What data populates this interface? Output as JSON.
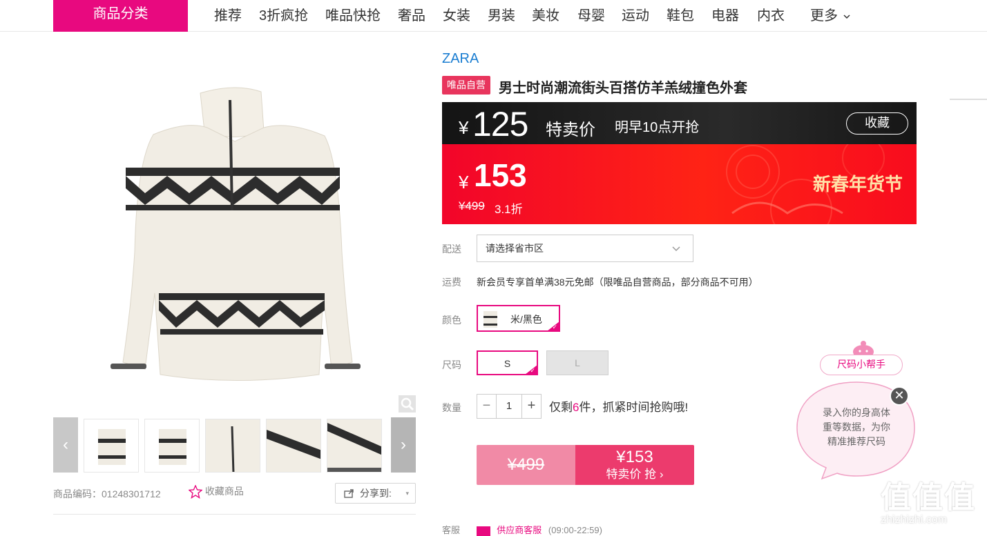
{
  "nav": {
    "category_button": "商品分类",
    "items": [
      "推荐",
      "3折疯抢",
      "唯品快抢",
      "奢品",
      "女装",
      "男装",
      "美妆",
      "母婴",
      "运动",
      "鞋包",
      "电器",
      "内衣"
    ],
    "more": "更多"
  },
  "product": {
    "brand": "ZARA",
    "badge": "唯品自营",
    "title": "男士时尚潮流街头百搭仿羊羔绒撞色外套",
    "code_label": "商品编码：01248301712",
    "favorite_label": "收藏商品",
    "share_label": "分享到:"
  },
  "promo": {
    "currency": "¥",
    "special_price": "125",
    "special_label": "特卖价",
    "start_time": "明早10点开抢",
    "collect_label": "收藏",
    "current_price": "153",
    "original_price": "¥499",
    "discount": "3.1折",
    "festival": "新春年货节"
  },
  "options": {
    "delivery_label": "配送",
    "delivery_placeholder": "请选择省市区",
    "shipping_label": "运费",
    "shipping_text": "新会员专享首单满38元免邮（限唯品自营商品，部分商品不可用）",
    "color_label": "颜色",
    "color_value": "米/黑色",
    "size_label": "尺码",
    "sizes": [
      "S",
      "L"
    ],
    "qty_label": "数量",
    "qty_value": "1",
    "stock_prefix": "仅剩",
    "stock_count": "6",
    "stock_suffix": "件，抓紧时间抢购哦!"
  },
  "buy": {
    "original_price": "¥499",
    "price": "¥153",
    "action": "特卖价 抢"
  },
  "helper": {
    "title": "尺码小帮手",
    "text_line1": "录入你的身高体",
    "text_line2": "重等数据，为你",
    "text_line3": "精准推荐尺码"
  },
  "service": {
    "label": "客服",
    "name": "供应商客服",
    "hours": "(09:00-22:59)"
  },
  "watermark": {
    "logo": "值值值",
    "domain": "zhizhizhi.com"
  }
}
